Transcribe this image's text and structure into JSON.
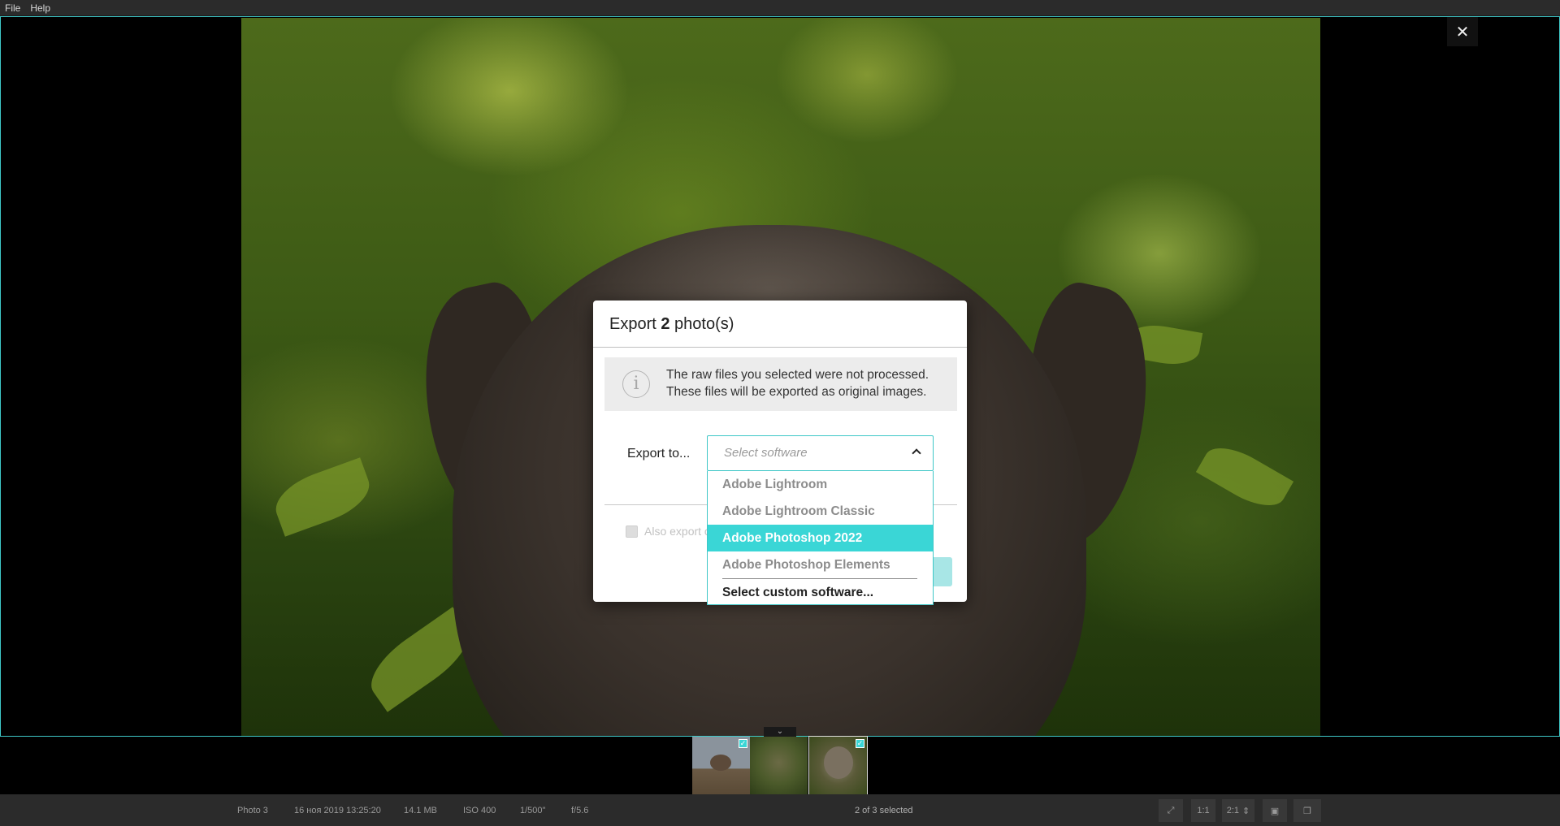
{
  "menubar": {
    "items": [
      "File",
      "Help"
    ]
  },
  "viewer": {
    "close_label": "✕"
  },
  "dialog": {
    "title_prefix": "Export ",
    "title_count": "2",
    "title_suffix": " photo(s)",
    "info_icon": "i",
    "info_line1": "The raw files you selected were not processed.",
    "info_line2": "These files will be exported as original images.",
    "export_label": "Export to...",
    "select_placeholder": "Select software",
    "also_export_label": "Also export o"
  },
  "dropdown": {
    "options": [
      "Adobe Lightroom",
      "Adobe Lightroom Classic",
      "Adobe Photoshop 2022",
      "Adobe Photoshop Elements"
    ],
    "selected_index": 2,
    "custom_option": "Select custom software..."
  },
  "filmstrip": {
    "toggle_icon": "chevron-down-icon",
    "thumbs": [
      {
        "checked": true,
        "check_glyph": "✓"
      },
      {
        "checked": false,
        "check_glyph": ""
      },
      {
        "checked": true,
        "check_glyph": "✓"
      }
    ]
  },
  "statusbar": {
    "photo_name": "Photo 3",
    "datetime": "16 ноя 2019 13:25:20",
    "size": "14.1 MB",
    "iso": "ISO 400",
    "shutter": "1/500\"",
    "aperture": "f/5.6",
    "selected": "2 of 3 selected",
    "zoom_1_1": "1:1",
    "zoom_2_1": "2:1"
  },
  "colors": {
    "accent": "#3ec7c7",
    "highlight": "#3ad6d6"
  }
}
